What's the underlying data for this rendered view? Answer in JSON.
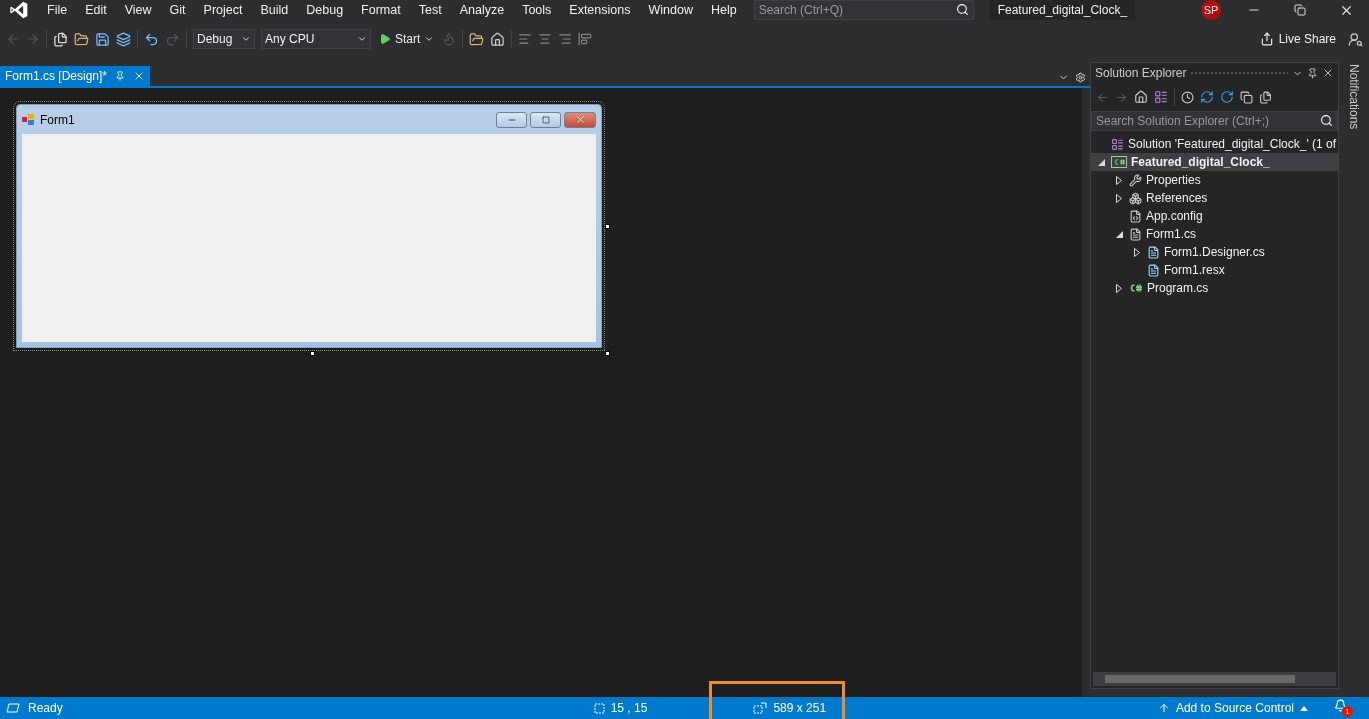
{
  "menu": [
    "File",
    "Edit",
    "View",
    "Git",
    "Project",
    "Build",
    "Debug",
    "Format",
    "Test",
    "Analyze",
    "Tools",
    "Extensions",
    "Window",
    "Help"
  ],
  "search": {
    "placeholder": "Search (Ctrl+Q)"
  },
  "solution_name": "Featured_digital_Clock_",
  "user_initials": "SP",
  "toolbar": {
    "configuration": "Debug",
    "platform": "Any CPU",
    "start": "Start",
    "live_share": "Live Share"
  },
  "tabs": [
    {
      "label": "Form1.cs [Design]*",
      "selected": true
    }
  ],
  "form": {
    "title": "Form1"
  },
  "solution_explorer": {
    "title": "Solution Explorer",
    "search_placeholder": "Search Solution Explorer (Ctrl+;)",
    "tree": [
      {
        "label": "Solution 'Featured_digital_Clock_' (1 of",
        "kind": "solution",
        "selected": false,
        "children": [
          {
            "label": "Featured_digital_Clock_",
            "kind": "project",
            "selected": true,
            "expanded": true,
            "children": [
              {
                "label": "Properties",
                "kind": "properties",
                "selected": false,
                "expanded": false
              },
              {
                "label": "References",
                "kind": "references",
                "selected": false,
                "expanded": false
              },
              {
                "label": "App.config",
                "kind": "config",
                "selected": false
              },
              {
                "label": "Form1.cs",
                "kind": "form",
                "selected": false,
                "expanded": true,
                "children": [
                  {
                    "label": "Form1.Designer.cs",
                    "kind": "file",
                    "selected": false,
                    "expanded": false
                  },
                  {
                    "label": "Form1.resx",
                    "kind": "file",
                    "selected": false
                  }
                ]
              },
              {
                "label": "Program.cs",
                "kind": "csharp",
                "selected": false,
                "expanded": false
              }
            ]
          }
        ]
      }
    ]
  },
  "notifications_label": "Notifications",
  "status_bar": {
    "state": "Ready",
    "position": "15 , 15",
    "size": "589 x 251",
    "source_control": "Add to Source Control",
    "notification_count": "1"
  }
}
